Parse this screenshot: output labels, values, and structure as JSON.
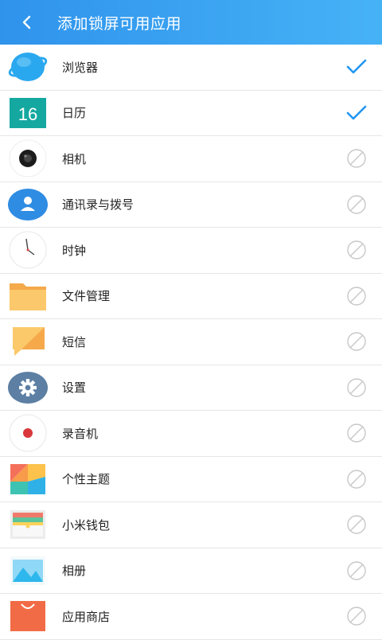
{
  "header": {
    "title": "添加锁屏可用应用",
    "background": "#3aa3f1"
  },
  "apps": [
    {
      "label": "浏览器",
      "icon": "browser-icon",
      "enabled": true
    },
    {
      "label": "日历",
      "icon": "calendar-icon",
      "enabled": true,
      "calendar_day": "16"
    },
    {
      "label": "相机",
      "icon": "camera-icon",
      "enabled": false
    },
    {
      "label": "通讯录与拨号",
      "icon": "contacts-icon",
      "enabled": false
    },
    {
      "label": "时钟",
      "icon": "clock-icon",
      "enabled": false
    },
    {
      "label": "文件管理",
      "icon": "folder-icon",
      "enabled": false
    },
    {
      "label": "短信",
      "icon": "messages-icon",
      "enabled": false
    },
    {
      "label": "设置",
      "icon": "settings-icon",
      "enabled": false
    },
    {
      "label": "录音机",
      "icon": "recorder-icon",
      "enabled": false
    },
    {
      "label": "个性主题",
      "icon": "themes-icon",
      "enabled": false
    },
    {
      "label": "小米钱包",
      "icon": "wallet-icon",
      "enabled": false
    },
    {
      "label": "相册",
      "icon": "gallery-icon",
      "enabled": false
    },
    {
      "label": "应用商店",
      "icon": "app-store-icon",
      "enabled": false
    }
  ],
  "colors": {
    "check": "#2196f3",
    "disabled": "#c8c8c8"
  }
}
